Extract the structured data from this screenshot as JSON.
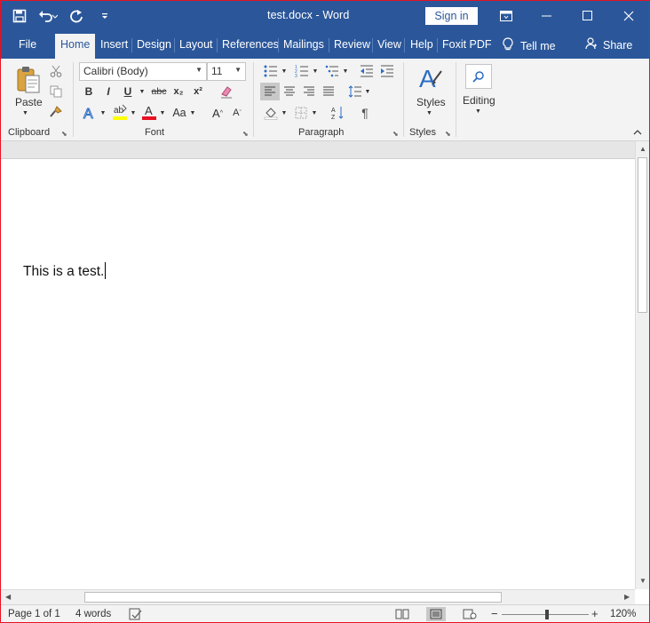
{
  "titlebar": {
    "doc_title": "test.docx  -  Word",
    "signin_label": "Sign in",
    "qat": {
      "save_icon": "save-icon",
      "undo_icon": "undo-icon",
      "redo_icon": "redo-icon",
      "customize_icon": "customize-icon"
    }
  },
  "tabs": [
    {
      "label": "File"
    },
    {
      "label": "Home"
    },
    {
      "label": "Insert"
    },
    {
      "label": "Design"
    },
    {
      "label": "Layout"
    },
    {
      "label": "References"
    },
    {
      "label": "Mailings"
    },
    {
      "label": "Review"
    },
    {
      "label": "View"
    },
    {
      "label": "Help"
    },
    {
      "label": "Foxit PDF"
    }
  ],
  "tell_me": "Tell me",
  "share": "Share",
  "ribbon": {
    "clipboard": {
      "label": "Clipboard",
      "paste_label": "Paste"
    },
    "font": {
      "label": "Font",
      "font_name": "Calibri (Body)",
      "font_size": "11",
      "bold": "B",
      "italic": "I",
      "underline": "U",
      "strike": "abc",
      "subscript": "x₂",
      "superscript": "x²",
      "grow": "A",
      "shrink": "A",
      "case": "Aa",
      "highlight_color": "#ffff00",
      "font_color": "#e81123"
    },
    "paragraph": {
      "label": "Paragraph",
      "pilcrow": "¶"
    },
    "styles": {
      "label": "Styles",
      "button_label": "Styles"
    },
    "editing": {
      "button_label": "Editing"
    }
  },
  "document": {
    "text": "This is a test."
  },
  "statusbar": {
    "page": "Page 1 of 1",
    "words": "4 words",
    "zoom_level": "120%",
    "zoom_minus": "−",
    "zoom_plus": "+"
  },
  "colors": {
    "accent": "#2b579a",
    "frame_border": "#e81123"
  }
}
